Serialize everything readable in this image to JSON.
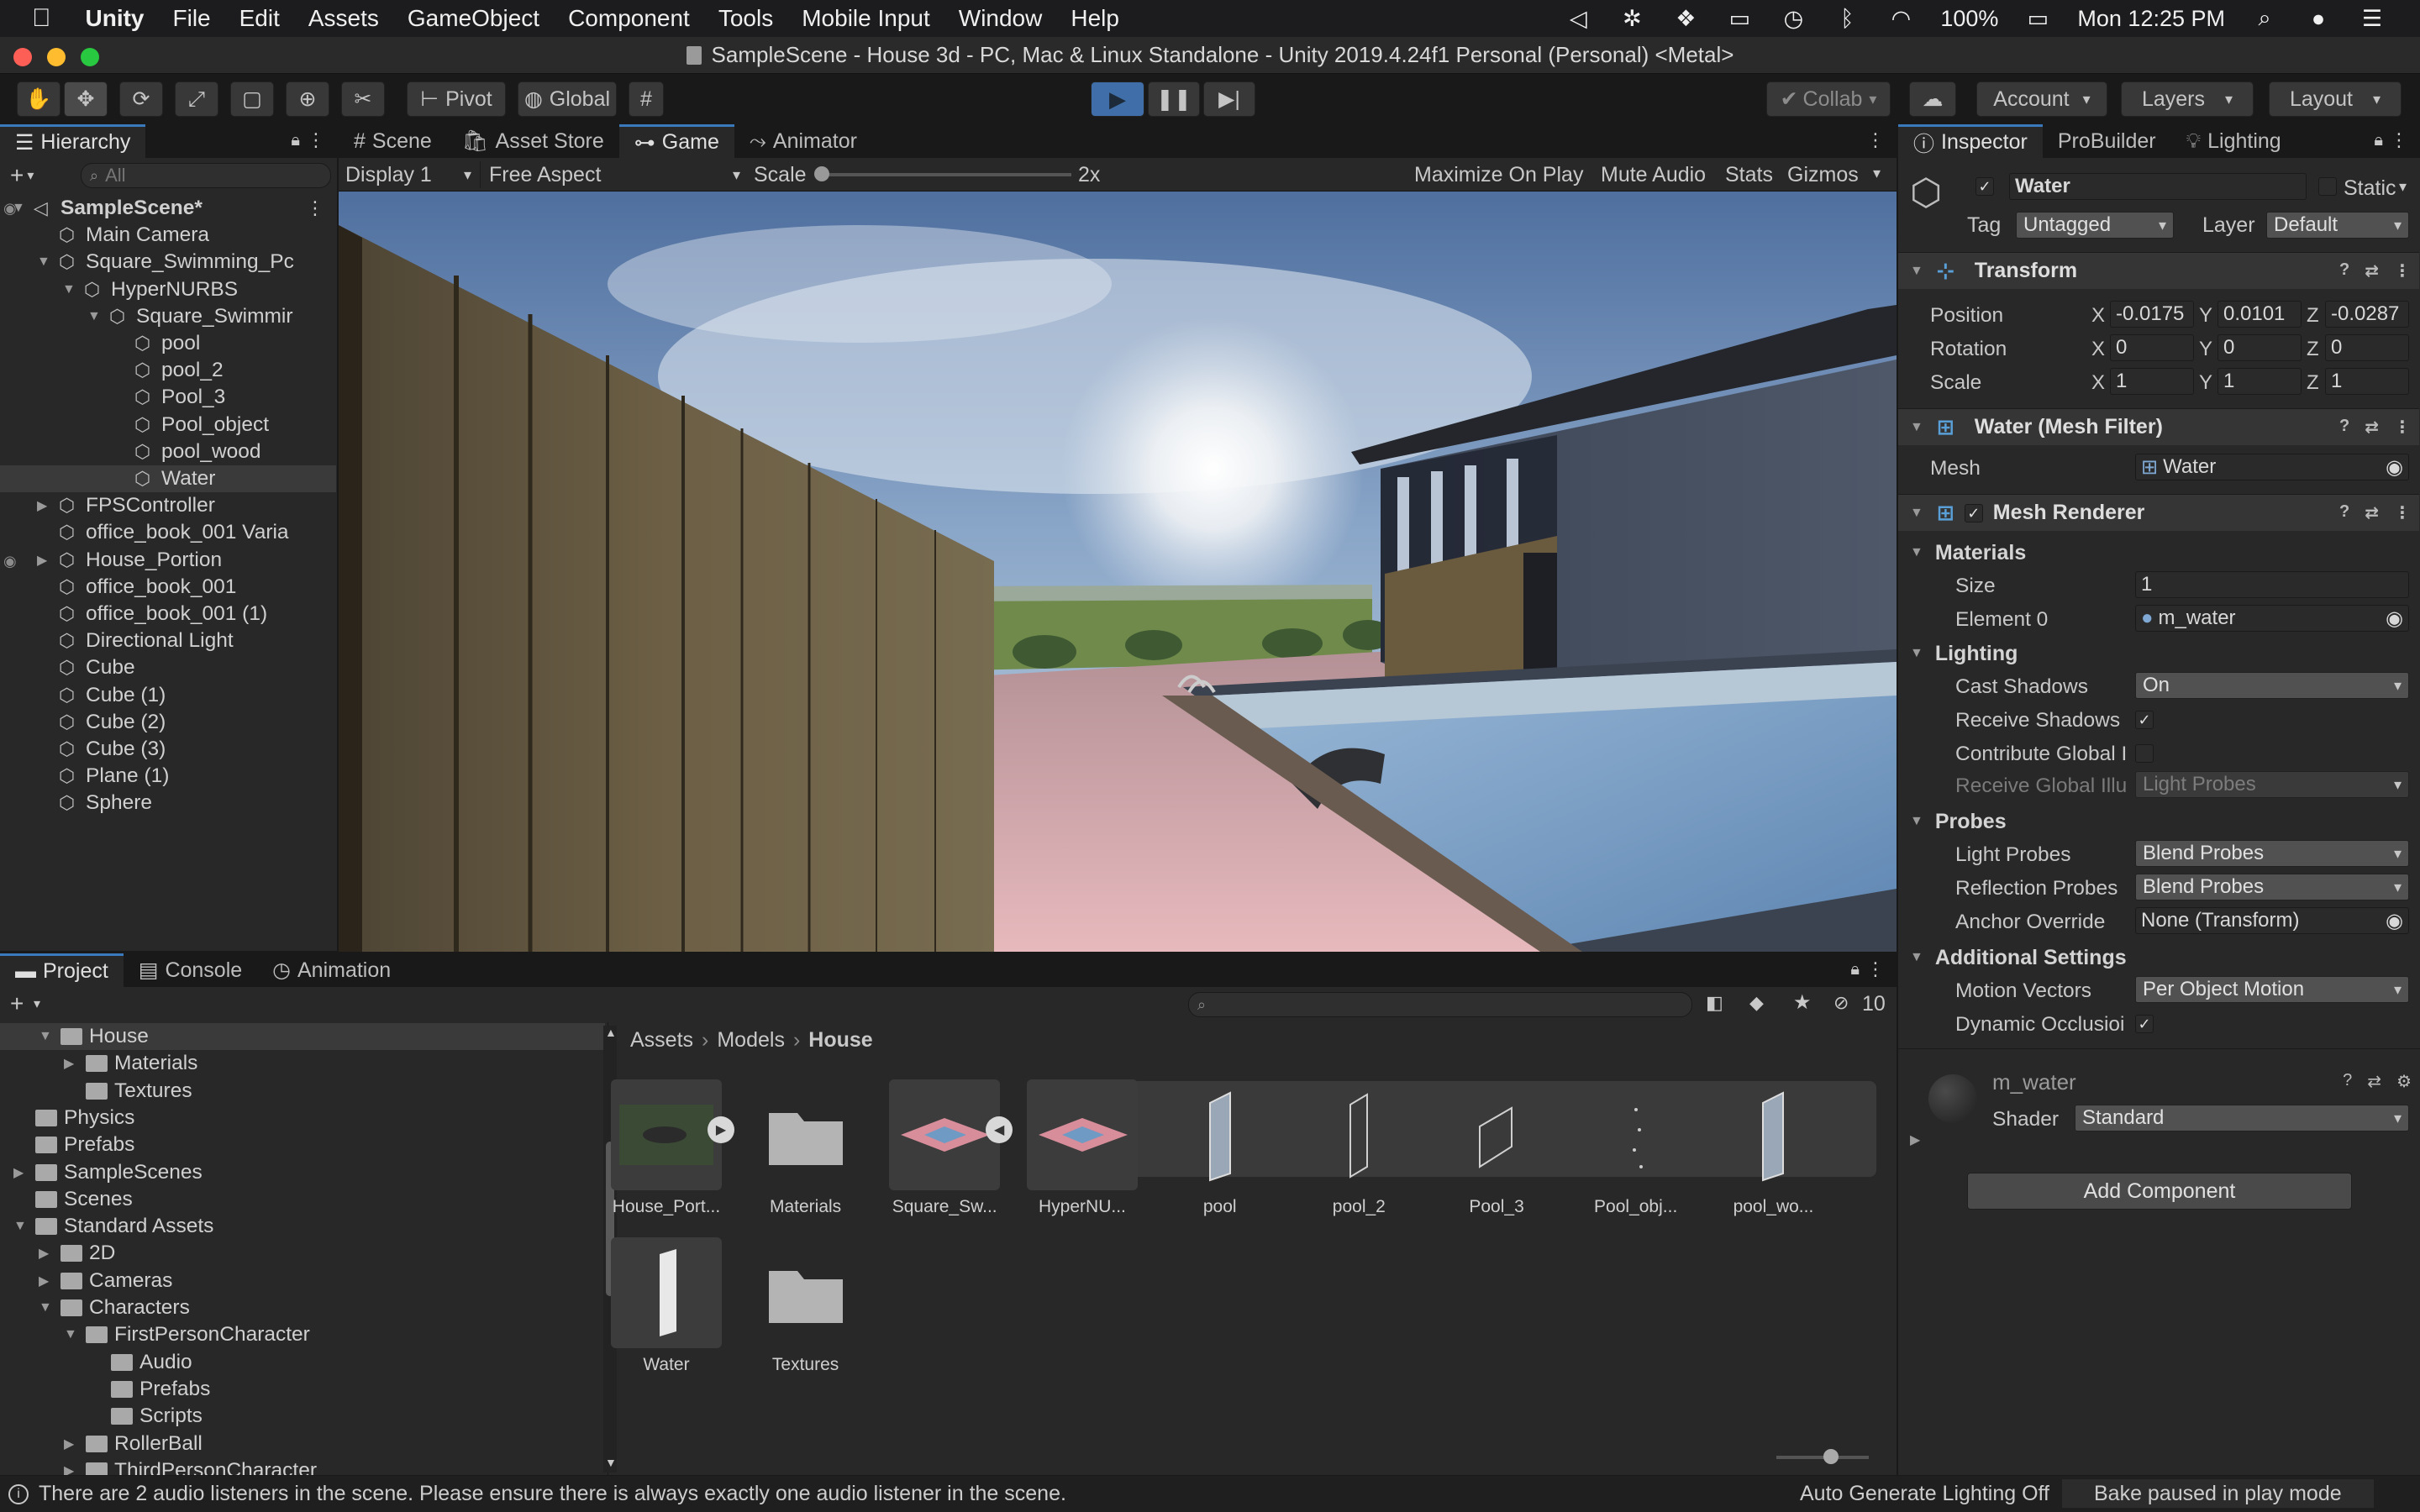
{
  "menubar": {
    "app": "Unity",
    "items": [
      "File",
      "Edit",
      "Assets",
      "GameObject",
      "Component",
      "Tools",
      "Mobile Input",
      "Window",
      "Help"
    ],
    "battery": "100%",
    "clock": "Mon 12:25 PM"
  },
  "window": {
    "title": "SampleScene - House 3d - PC, Mac & Linux Standalone - Unity 2019.4.24f1 Personal (Personal) <Metal>"
  },
  "toolbar": {
    "pivot": "Pivot",
    "global": "Global",
    "collab": "Collab",
    "account": "Account",
    "layers": "Layers",
    "layout": "Layout"
  },
  "hierarchy": {
    "tab": "Hierarchy",
    "search_placeholder": "All",
    "items": [
      {
        "label": "SampleScene*",
        "depth": 0,
        "arrow": "▼",
        "bold": true,
        "icon": "scene"
      },
      {
        "label": "Main Camera",
        "depth": 1,
        "arrow": "",
        "icon": "cube"
      },
      {
        "label": "Square_Swimming_Pc",
        "depth": 1,
        "arrow": "▼",
        "icon": "cube"
      },
      {
        "label": "HyperNURBS",
        "depth": 2,
        "arrow": "▼",
        "icon": "cube"
      },
      {
        "label": "Square_Swimmir",
        "depth": 3,
        "arrow": "▼",
        "icon": "cube"
      },
      {
        "label": "pool",
        "depth": 4,
        "arrow": "",
        "icon": "cube"
      },
      {
        "label": "pool_2",
        "depth": 4,
        "arrow": "",
        "icon": "cube"
      },
      {
        "label": "Pool_3",
        "depth": 4,
        "arrow": "",
        "icon": "cube"
      },
      {
        "label": "Pool_object",
        "depth": 4,
        "arrow": "",
        "icon": "cube"
      },
      {
        "label": "pool_wood",
        "depth": 4,
        "arrow": "",
        "icon": "cube"
      },
      {
        "label": "Water",
        "depth": 4,
        "arrow": "",
        "icon": "cube",
        "selected": true
      },
      {
        "label": "FPSController",
        "depth": 1,
        "arrow": "▶",
        "icon": "cube"
      },
      {
        "label": "office_book_001 Varia",
        "depth": 1,
        "arrow": "",
        "icon": "cube"
      },
      {
        "label": "House_Portion",
        "depth": 1,
        "arrow": "▶",
        "icon": "cube"
      },
      {
        "label": "office_book_001",
        "depth": 1,
        "arrow": "",
        "icon": "cube"
      },
      {
        "label": "office_book_001 (1)",
        "depth": 1,
        "arrow": "",
        "icon": "cube"
      },
      {
        "label": "Directional Light",
        "depth": 1,
        "arrow": "",
        "icon": "cube"
      },
      {
        "label": "Cube",
        "depth": 1,
        "arrow": "",
        "icon": "cube"
      },
      {
        "label": "Cube (1)",
        "depth": 1,
        "arrow": "",
        "icon": "cube"
      },
      {
        "label": "Cube (2)",
        "depth": 1,
        "arrow": "",
        "icon": "cube"
      },
      {
        "label": "Cube (3)",
        "depth": 1,
        "arrow": "",
        "icon": "cube"
      },
      {
        "label": "Plane (1)",
        "depth": 1,
        "arrow": "",
        "icon": "cube"
      },
      {
        "label": "Sphere",
        "depth": 1,
        "arrow": "",
        "icon": "cube"
      }
    ]
  },
  "viewtabs": {
    "scene": "Scene",
    "asset_store": "Asset Store",
    "game": "Game",
    "animator": "Animator"
  },
  "gamebar": {
    "display": "Display 1",
    "aspect": "Free Aspect",
    "scale_label": "Scale",
    "scale_value": "2x",
    "maximize": "Maximize On Play",
    "mute": "Mute Audio",
    "stats": "Stats",
    "gizmos": "Gizmos"
  },
  "inspector": {
    "tabs": [
      "Inspector",
      "ProBuilder",
      "Lighting"
    ],
    "object_name": "Water",
    "static_label": "Static",
    "tag_label": "Tag",
    "tag_value": "Untagged",
    "layer_label": "Layer",
    "layer_value": "Default",
    "transform": {
      "title": "Transform",
      "position_label": "Position",
      "rotation_label": "Rotation",
      "scale_label": "Scale",
      "position": [
        "-0.0175",
        "0.0101",
        "-0.0287"
      ],
      "rotation": [
        "0",
        "0",
        "0"
      ],
      "scale": [
        "1",
        "1",
        "1"
      ]
    },
    "mesh_filter": {
      "title": "Water (Mesh Filter)",
      "mesh_label": "Mesh",
      "mesh_value": "Water"
    },
    "mesh_renderer": {
      "title": "Mesh Renderer",
      "materials": "Materials",
      "size_label": "Size",
      "size_value": "1",
      "element0_label": "Element 0",
      "element0_value": "m_water",
      "lighting": "Lighting",
      "cast_shadows_label": "Cast Shadows",
      "cast_shadows_value": "On",
      "receive_shadows_label": "Receive Shadows",
      "contribute_gi_label": "Contribute Global I",
      "receive_gi_label": "Receive Global Illu",
      "receive_gi_value": "Light Probes",
      "probes": "Probes",
      "light_probes_label": "Light Probes",
      "light_probes_value": "Blend Probes",
      "reflection_probes_label": "Reflection Probes",
      "reflection_probes_value": "Blend Probes",
      "anchor_override_label": "Anchor Override",
      "anchor_override_value": "None (Transform)",
      "additional": "Additional Settings",
      "motion_vectors_label": "Motion Vectors",
      "motion_vectors_value": "Per Object Motion",
      "dynamic_occlusion_label": "Dynamic Occlusioi"
    },
    "material": {
      "name": "m_water",
      "shader_label": "Shader",
      "shader_value": "Standard"
    },
    "add_component": "Add Component"
  },
  "project": {
    "tabs": [
      "Project",
      "Console",
      "Animation"
    ],
    "hidden_count": "10",
    "breadcrumb": [
      "Assets",
      "Models",
      "House"
    ],
    "tree": [
      {
        "label": "House",
        "depth": 2,
        "arrow": "▼",
        "selected": true
      },
      {
        "label": "Materials",
        "depth": 3,
        "arrow": "▶"
      },
      {
        "label": "Textures",
        "depth": 3,
        "arrow": ""
      },
      {
        "label": "Physics",
        "depth": 1,
        "arrow": ""
      },
      {
        "label": "Prefabs",
        "depth": 1,
        "arrow": ""
      },
      {
        "label": "SampleScenes",
        "depth": 1,
        "arrow": "▶"
      },
      {
        "label": "Scenes",
        "depth": 1,
        "arrow": ""
      },
      {
        "label": "Standard Assets",
        "depth": 1,
        "arrow": "▼"
      },
      {
        "label": "2D",
        "depth": 2,
        "arrow": "▶"
      },
      {
        "label": "Cameras",
        "depth": 2,
        "arrow": "▶"
      },
      {
        "label": "Characters",
        "depth": 2,
        "arrow": "▼"
      },
      {
        "label": "FirstPersonCharacter",
        "depth": 3,
        "arrow": "▼"
      },
      {
        "label": "Audio",
        "depth": 4,
        "arrow": ""
      },
      {
        "label": "Prefabs",
        "depth": 4,
        "arrow": ""
      },
      {
        "label": "Scripts",
        "depth": 4,
        "arrow": ""
      },
      {
        "label": "RollerBall",
        "depth": 3,
        "arrow": "▶"
      },
      {
        "label": "ThirdPersonCharacter",
        "depth": 3,
        "arrow": "▶"
      }
    ],
    "assets": [
      {
        "label": "House_Port...",
        "kind": "model-green"
      },
      {
        "label": "Materials",
        "kind": "folder"
      },
      {
        "label": "Square_Sw...",
        "kind": "model-pink"
      },
      {
        "label": "HyperNU...",
        "kind": "model-pink"
      },
      {
        "label": "pool",
        "kind": "mesh-tall"
      },
      {
        "label": "pool_2",
        "kind": "mesh-thin"
      },
      {
        "label": "Pool_3",
        "kind": "mesh-quad"
      },
      {
        "label": "Pool_obj...",
        "kind": "mesh-dots"
      },
      {
        "label": "pool_wo...",
        "kind": "mesh-tall"
      },
      {
        "label": "Water",
        "kind": "mesh-white"
      },
      {
        "label": "Textures",
        "kind": "folder"
      }
    ]
  },
  "statusbar": {
    "message": "There are 2 audio listeners in the scene. Please ensure there is always exactly one audio listener in the scene.",
    "auto_lighting": "Auto Generate Lighting Off",
    "bake": "Bake paused in play mode"
  }
}
